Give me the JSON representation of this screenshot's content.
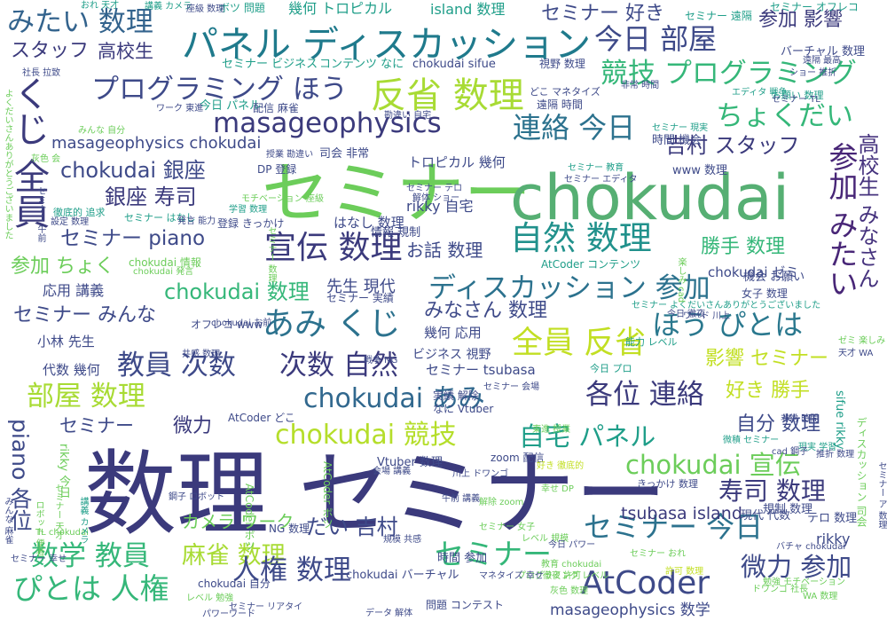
{
  "words": [
    {
      "text": "数理 セミナー",
      "color": "#3b3a7c"
    },
    {
      "text": "セミナー",
      "color": "#6ccd5a"
    },
    {
      "text": "chokudai",
      "color": "#56af73"
    },
    {
      "text": "パネル ディスカッション",
      "color": "#1f7a8c"
    },
    {
      "text": "反省 数理",
      "color": "#a8db34"
    },
    {
      "text": "くじ 全員",
      "color": "#3b3a7c"
    },
    {
      "text": "みたい 数理",
      "color": "#33638d"
    },
    {
      "text": "今日 部屋",
      "color": "#3e4a89"
    },
    {
      "text": "プログラミング ほう",
      "color": "#3e4a89"
    },
    {
      "text": "競技 プログラミング",
      "color": "#35b779"
    },
    {
      "text": "masageophysics",
      "color": "#3b3a7c"
    },
    {
      "text": "連絡 今日",
      "color": "#2c728e"
    },
    {
      "text": "ちょくだい",
      "color": "#35b779"
    },
    {
      "text": "宣伝 数理",
      "color": "#3b3a7c"
    },
    {
      "text": "自然 数理",
      "color": "#21918c"
    },
    {
      "text": "参加 みたい",
      "color": "#482677"
    },
    {
      "text": "高校生 みなさん",
      "color": "#46337e"
    },
    {
      "text": "あみ くじ",
      "color": "#2c728e"
    },
    {
      "text": "ディスカッション 参加",
      "color": "#2c728e"
    },
    {
      "text": "全員 反省",
      "color": "#c2df23"
    },
    {
      "text": "ほう ぴとは",
      "color": "#2a788e"
    },
    {
      "text": "教員 次数",
      "color": "#3e4a89"
    },
    {
      "text": "次数 自然",
      "color": "#3b3a7c"
    },
    {
      "text": "chokudai あみ",
      "color": "#31688e"
    },
    {
      "text": "各位 連絡",
      "color": "#3b3a7c"
    },
    {
      "text": "部屋 数理",
      "color": "#a8db34"
    },
    {
      "text": "chokudai 競技",
      "color": "#b5de2b"
    },
    {
      "text": "自宅 パネル",
      "color": "#1f9e89"
    },
    {
      "text": "chokudai 宣伝",
      "color": "#6ccd5a"
    },
    {
      "text": "数学 教員",
      "color": "#35b779"
    },
    {
      "text": "麻雀 数理",
      "color": "#a8db34"
    },
    {
      "text": "セミナー 今日",
      "color": "#2c728e"
    },
    {
      "text": "ぴとは 人権",
      "color": "#35b779"
    },
    {
      "text": "人権 数理",
      "color": "#3e4a89"
    },
    {
      "text": "AtCoder",
      "color": "#3e4a89"
    },
    {
      "text": "セミナー",
      "color": "#35b779"
    },
    {
      "text": "微力 参加",
      "color": "#3e4a89"
    },
    {
      "text": "寿司 数理",
      "color": "#3b3a7c"
    },
    {
      "text": "tsubasa island",
      "color": "#3b3a7c"
    },
    {
      "text": "piano 各位",
      "color": "#3e4a89"
    },
    {
      "text": "セミナー piano",
      "color": "#3e4a89"
    },
    {
      "text": "銀座 寿司",
      "color": "#3b3a7c"
    },
    {
      "text": "chokudai 銀座",
      "color": "#3e4a89"
    },
    {
      "text": "参加 影響",
      "color": "#3b3a7c"
    },
    {
      "text": "吉村 スタッフ",
      "color": "#3b3a7c"
    },
    {
      "text": "高校生",
      "color": "#3b3a7c"
    },
    {
      "text": "スタッフ",
      "color": "#3b3a7c"
    },
    {
      "text": "セミナー 好き",
      "color": "#3e4a89"
    },
    {
      "text": "chokudai 数理",
      "color": "#35b779"
    },
    {
      "text": "セミナー みんな",
      "color": "#3e4a89"
    },
    {
      "text": "参加 ちょく",
      "color": "#6ccd5a"
    },
    {
      "text": "好き 勝手",
      "color": "#c2df23"
    },
    {
      "text": "勝手 数理",
      "color": "#35b779"
    },
    {
      "text": "影響 セミナー",
      "color": "#c2df23"
    },
    {
      "text": "だい 吉村",
      "color": "#3e4a89"
    },
    {
      "text": "自分 数理",
      "color": "#3e4a89"
    },
    {
      "text": "微力",
      "color": "#3b3a7c"
    },
    {
      "text": "セミナー",
      "color": "#3e4a89"
    },
    {
      "text": "みなさん 数理",
      "color": "#3e4a89"
    },
    {
      "text": "お話 数理",
      "color": "#3e4a89"
    },
    {
      "text": "先生 現代",
      "color": "#3e4a89"
    },
    {
      "text": "masageophysics chokudai",
      "color": "#3e4a89"
    },
    {
      "text": "masageophysics 数学",
      "color": "#3e4a89"
    },
    {
      "text": "カメラ ワーク",
      "color": "#6ccd5a"
    },
    {
      "text": "幾何 トロピカル",
      "color": "#1f9e89"
    },
    {
      "text": "island 数理",
      "color": "#1f9e89"
    },
    {
      "text": "コンテンツ なに",
      "color": "#1f9e89"
    },
    {
      "text": "セミナー ビジネス",
      "color": "#1f9e89"
    },
    {
      "text": "chokudai sifue",
      "color": "#3e4a89"
    },
    {
      "text": "トロピカル 幾何",
      "color": "#3e4a89"
    },
    {
      "text": "rikky 自宅",
      "color": "#3e4a89"
    },
    {
      "text": "はなし 数理",
      "color": "#3e4a89"
    },
    {
      "text": "情報 規制",
      "color": "#3e4a89"
    },
    {
      "text": "応用 講義",
      "color": "#3e4a89"
    },
    {
      "text": "代数 幾何",
      "color": "#3e4a89"
    },
    {
      "text": "小林 先生",
      "color": "#3e4a89"
    },
    {
      "text": "幾何 応用",
      "color": "#3e4a89"
    },
    {
      "text": "ビジネス 視野",
      "color": "#3e4a89"
    },
    {
      "text": "セミナー tsubasa",
      "color": "#3e4a89"
    },
    {
      "text": "実績 解除",
      "color": "#3e4a89"
    },
    {
      "text": "なに Vtuber",
      "color": "#3e4a89"
    },
    {
      "text": "AtCoder どこ",
      "color": "#3e4a89"
    },
    {
      "text": "Vtuber 数理",
      "color": "#3e4a89"
    },
    {
      "text": "zoom 配信",
      "color": "#3e4a89"
    },
    {
      "text": "時間 参加",
      "color": "#3e4a89"
    },
    {
      "text": "chokudai バーチャル",
      "color": "#3e4a89"
    },
    {
      "text": "chokudai 自分",
      "color": "#3e4a89"
    },
    {
      "text": "問題 コンテスト",
      "color": "#3e4a89"
    },
    {
      "text": "NG 数理",
      "color": "#3e4a89"
    },
    {
      "text": "rikky",
      "color": "#3e4a89"
    },
    {
      "text": "テロ 数理",
      "color": "#3e4a89"
    },
    {
      "text": "規制 数理",
      "color": "#3e4a89"
    },
    {
      "text": "現代 代数",
      "color": "#3e4a89"
    },
    {
      "text": "chokudai ゼミ",
      "color": "#3e4a89"
    },
    {
      "text": "機会 お願い",
      "color": "#3e4a89"
    },
    {
      "text": "女子 数理",
      "color": "#3e4a89"
    },
    {
      "text": "www 数理",
      "color": "#3e4a89"
    },
    {
      "text": "時間 機会",
      "color": "#3e4a89"
    },
    {
      "text": "セミナー 遠隔",
      "color": "#1f9e89"
    },
    {
      "text": "セミナー オフレコ",
      "color": "#1f9e89"
    },
    {
      "text": "バーチャル 数理",
      "color": "#3e4a89"
    },
    {
      "text": "視野 数理",
      "color": "#3e4a89"
    },
    {
      "text": "どこ マネタイズ",
      "color": "#3e4a89"
    },
    {
      "text": "遠隔 時間",
      "color": "#3e4a89"
    },
    {
      "text": "今日 パネル",
      "color": "#1f9e89"
    },
    {
      "text": "配信 麻雀",
      "color": "#3e4a89"
    },
    {
      "text": "司会 非常",
      "color": "#3e4a89"
    },
    {
      "text": "DP 登録",
      "color": "#3e4a89"
    },
    {
      "text": "登録 きっかけ",
      "color": "#3e4a89"
    },
    {
      "text": "AtCoder コンテンツ",
      "color": "#1f9e89"
    },
    {
      "text": "chokudai 情報",
      "color": "#6ccd5a"
    },
    {
      "text": "セミナー 実績",
      "color": "#3e4a89"
    },
    {
      "text": "オフレコ www",
      "color": "#3e4a89"
    },
    {
      "text": "chokudai 発言",
      "color": "#6ccd5a"
    },
    {
      "text": "セミナー 現実",
      "color": "#1f9e89"
    },
    {
      "text": "ボツ 問題",
      "color": "#1f9e89"
    },
    {
      "text": "講義 カメラ",
      "color": "#1f9e89"
    },
    {
      "text": "おれ 天才",
      "color": "#1f9e89"
    },
    {
      "text": "セミナー はなし",
      "color": "#1f9e89"
    },
    {
      "text": "学習 数理",
      "color": "#1f9e89"
    },
    {
      "text": "徹底的 追求",
      "color": "#1f9e89"
    },
    {
      "text": "今日 徹夜",
      "color": "#3e4a89"
    },
    {
      "text": "ワード 川上",
      "color": "#3e4a89"
    },
    {
      "text": "能力 レベル",
      "color": "#1f9e89"
    },
    {
      "text": "今日 プロ",
      "color": "#1f9e89"
    },
    {
      "text": "セミナー 教育",
      "color": "#1f9e89"
    },
    {
      "text": "エディタ 戦争",
      "color": "#1f9e89"
    },
    {
      "text": "お願い 数理",
      "color": "#1f9e89"
    },
    {
      "text": "戦争 NG",
      "color": "#3e4a89"
    },
    {
      "text": "AtCoder ボツ",
      "color": "#6ccd5a"
    },
    {
      "text": "きっかけ 数理",
      "color": "#3e4a89"
    },
    {
      "text": "微積 セミナー",
      "color": "#1f9e89"
    },
    {
      "text": "sifue rikky",
      "color": "#1f9e89"
    },
    {
      "text": "現実 学習",
      "color": "#1f9e89"
    },
    {
      "text": "天才 WA",
      "color": "#3e4a89"
    },
    {
      "text": "セミナー よくだいさんありがとうございました",
      "color": "#1f9e89"
    },
    {
      "text": "よくだいさんありがとうございました",
      "color": "#6ccd5a"
    },
    {
      "text": "rikky 今日",
      "color": "#6ccd5a"
    },
    {
      "text": "AtCoder ボツ",
      "color": "#6ccd5a"
    },
    {
      "text": "ディスカッション 司会",
      "color": "#6ccd5a"
    },
    {
      "text": "幸せ DP",
      "color": "#6ccd5a"
    },
    {
      "text": "好き 徹底的",
      "color": "#c2df23"
    },
    {
      "text": "セミナー 女子",
      "color": "#6ccd5a"
    },
    {
      "text": "解除 zoom",
      "color": "#6ccd5a"
    },
    {
      "text": "教育 chokudai",
      "color": "#6ccd5a"
    },
    {
      "text": "徹夜 許可",
      "color": "#6ccd5a"
    },
    {
      "text": "灰色 数理",
      "color": "#6ccd5a"
    },
    {
      "text": "セミナー おれ",
      "color": "#6ccd5a"
    },
    {
      "text": "許可 数理",
      "color": "#c2df23"
    },
    {
      "text": "勉強 モチベーション",
      "color": "#6ccd5a"
    },
    {
      "text": "WA 数理",
      "color": "#6ccd5a"
    },
    {
      "text": "バチャ chokudai",
      "color": "#3e4a89"
    },
    {
      "text": "パワーワード",
      "color": "#3e4a89"
    },
    {
      "text": "データ 解体",
      "color": "#3e4a89"
    },
    {
      "text": "規模 共感",
      "color": "#3e4a89"
    },
    {
      "text": "レベル 規模",
      "color": "#6ccd5a"
    },
    {
      "text": "プログラミング レベル",
      "color": "#6ccd5a"
    },
    {
      "text": "鋼子 ロボット",
      "color": "#3e4a89"
    },
    {
      "text": "東進 授業",
      "color": "#6ccd5a"
    },
    {
      "text": "午前 講義",
      "color": "#3e4a89"
    },
    {
      "text": "川上 ドワンゴ",
      "color": "#3e4a89"
    },
    {
      "text": "会場 講義",
      "color": "#3e4a89"
    },
    {
      "text": "共感 数理",
      "color": "#3e4a89"
    },
    {
      "text": "chokudai お前",
      "color": "#3e4a89"
    },
    {
      "text": "マネタイズ 幸せ",
      "color": "#3e4a89"
    },
    {
      "text": "発言 能力",
      "color": "#3e4a89"
    },
    {
      "text": "解体 ショー",
      "color": "#3e4a89"
    },
    {
      "text": "セミナー テロ",
      "color": "#3e4a89"
    },
    {
      "text": "セミナー エディタ",
      "color": "#3e4a89"
    },
    {
      "text": "レベル 勉強",
      "color": "#6ccd5a"
    },
    {
      "text": "セミナー 会場",
      "color": "#3e4a89"
    },
    {
      "text": "ショー 推折",
      "color": "#3e4a89"
    },
    {
      "text": "遠隔 最高",
      "color": "#3e4a89"
    },
    {
      "text": "セミナー TL",
      "color": "#3e4a89"
    },
    {
      "text": "セミナー 幸せ",
      "color": "#3e4a89"
    },
    {
      "text": "TL chokudai",
      "color": "#6ccd5a"
    },
    {
      "text": "ドワンゴ 社長",
      "color": "#6ccd5a"
    },
    {
      "text": "セミナー リアタイ",
      "color": "#3e4a89"
    },
    {
      "text": "セミナー ア 数理",
      "color": "#3e4a89"
    },
    {
      "text": "cad 鋼子",
      "color": "#3e4a89"
    },
    {
      "text": "楽しみ cad",
      "color": "#6ccd5a"
    },
    {
      "text": "ゼミ 楽しみ",
      "color": "#6ccd5a"
    },
    {
      "text": "非常 時間",
      "color": "#3e4a89"
    },
    {
      "text": "ロボット 便者",
      "color": "#6ccd5a"
    },
    {
      "text": "灰色 会",
      "color": "#6ccd5a"
    },
    {
      "text": "推折 数理",
      "color": "#3e4a89"
    },
    {
      "text": "モチベーション 座級",
      "color": "#6ccd5a"
    },
    {
      "text": "社長 拉致",
      "color": "#3e4a89"
    },
    {
      "text": "みんな 自分",
      "color": "#6ccd5a"
    },
    {
      "text": "講義 カメラ",
      "color": "#1f9e89"
    },
    {
      "text": "座級 数理",
      "color": "#3e4a89"
    },
    {
      "text": "セミナー 午前",
      "color": "#3e4a89"
    },
    {
      "text": "みんな 麻雀",
      "color": "#3e4a89"
    },
    {
      "text": "セミナー 天才",
      "color": "#6ccd5a"
    },
    {
      "text": "非常 時間",
      "color": "#3e4a89"
    },
    {
      "text": "設定 数理",
      "color": "#3e4a89"
    },
    {
      "text": "授業 勘違い",
      "color": "#3e4a89"
    },
    {
      "text": "勘違い 自宅",
      "color": "#3e4a89"
    },
    {
      "text": "ワーク 東進",
      "color": "#3e4a89"
    },
    {
      "text": "セミナー 数理",
      "color": "#6ccd5a"
    },
    {
      "text": "今日 パワー",
      "color": "#3e4a89"
    }
  ]
}
